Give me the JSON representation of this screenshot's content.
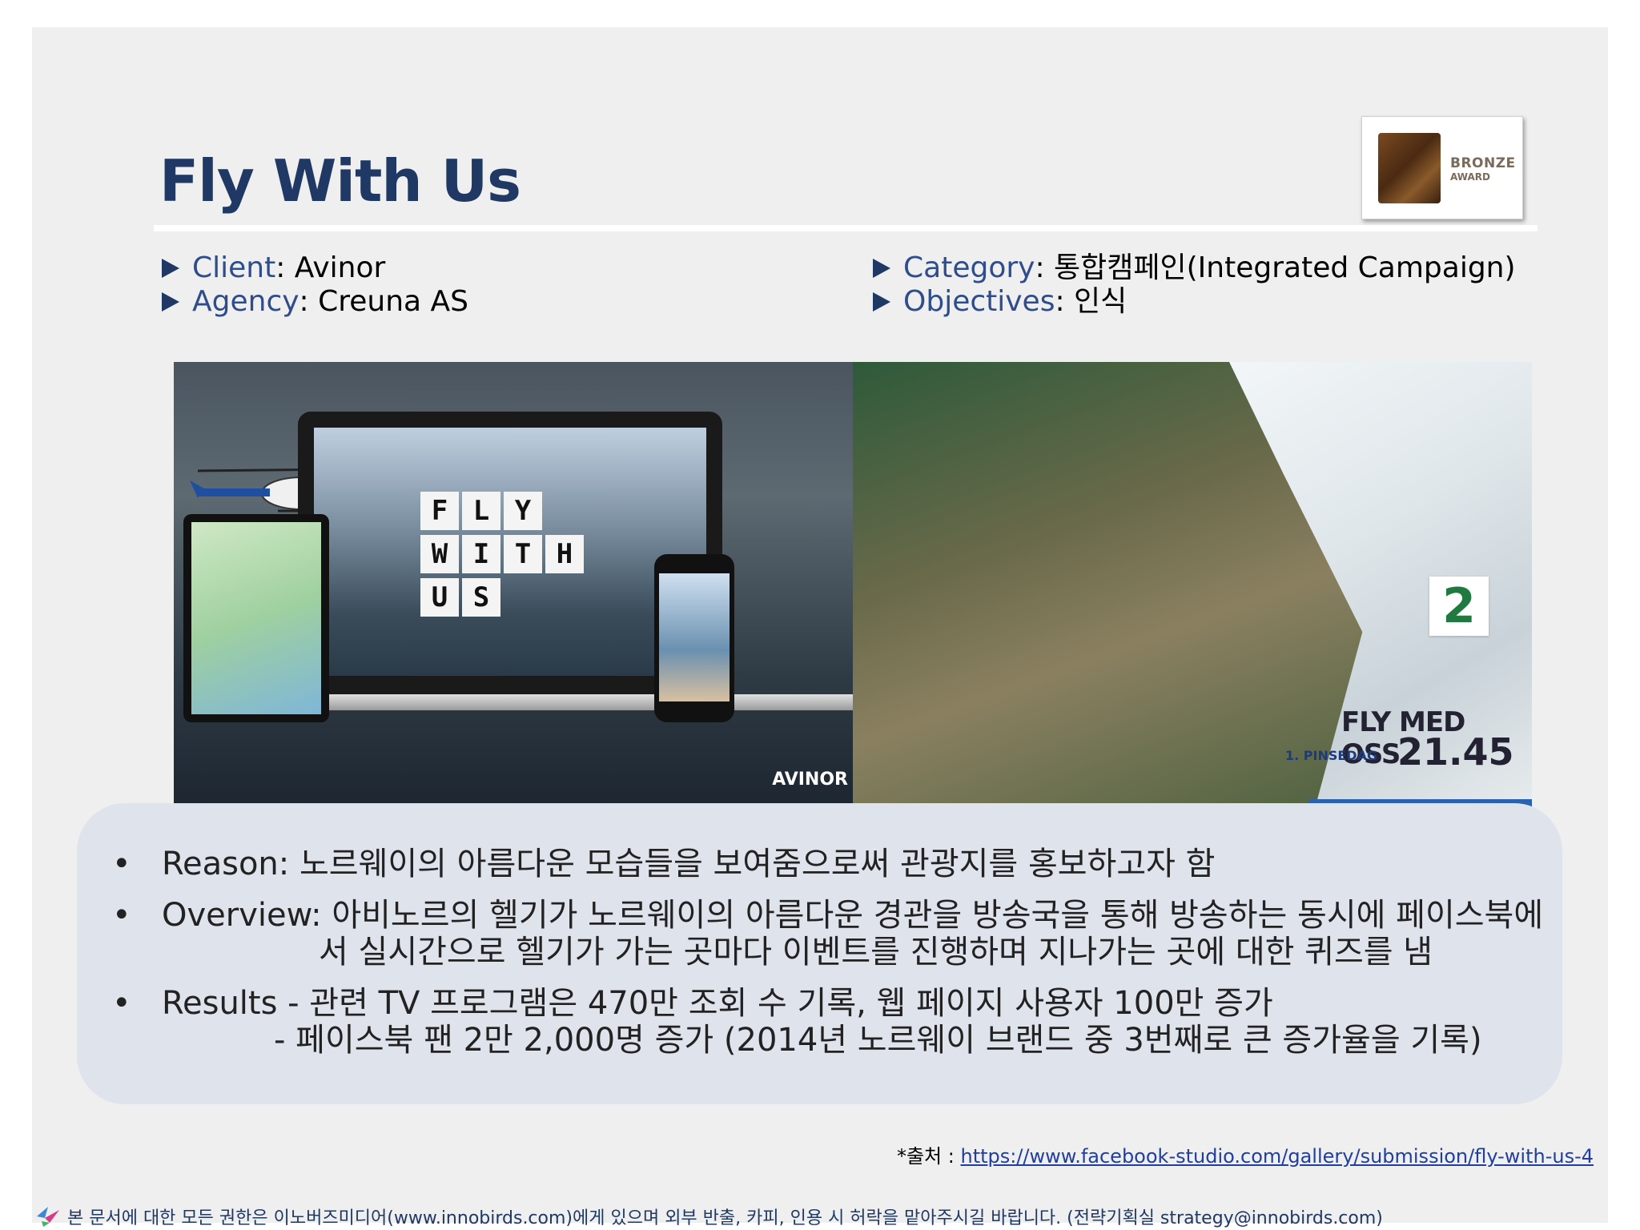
{
  "slide": {
    "title": "Fly With Us",
    "award": {
      "line1": "BRONZE",
      "line2": "AWARD"
    }
  },
  "meta": {
    "client_key": "Client",
    "client_value": ": Avinor",
    "agency_key": "Agency",
    "agency_value": ": Creuna AS",
    "category_key": "Category",
    "category_value": ": 통합캠페인(Integrated Campaign)",
    "objectives_key": "Objectives",
    "objectives_value": ": 인식"
  },
  "images": {
    "left": {
      "fws_rows": [
        [
          "F",
          "L",
          "Y"
        ],
        [
          "W",
          "I",
          "T",
          "H"
        ],
        [
          "U",
          "S"
        ]
      ],
      "brand": "AVINOR"
    },
    "right": {
      "channel_logo": "2",
      "show_title": "FLY MED OSS",
      "show_date": "1. PINSEDAG",
      "show_time": "21.45"
    }
  },
  "bullets": {
    "marker": "•",
    "reason": "Reason: 노르웨이의 아름다운 모습들을 보여줌으로써 관광지를 홍보하고자 함",
    "overview_1": "Overview: 아비노르의 헬기가 노르웨이의 아름다운 경관을 방송국을 통해 방송하는 동시에 페이스북에",
    "overview_2": "서 실시간으로 헬기가 가는 곳마다 이벤트를 진행하며 지나가는 곳에 대한 퀴즈를 냄",
    "results_1": "Results - 관련 TV 프로그램은 470만 조회 수 기록, 웹 페이지 사용자 100만 증가",
    "results_2": "- 페이스북 팬 2만 2,000명 증가 (2014년 노르웨이 브랜드 중 3번째로 큰 증가율을 기록)"
  },
  "source": {
    "label": "*출처 : ",
    "url": "https://www.facebook-studio.com/gallery/submission/fly-with-us-4"
  },
  "footer": {
    "text": "본 문서에 대한 모든 권한은 이노버즈미디어(www.innobirds.com)에게 있으며 외부 반출, 카피, 인용 시 허락을 맡아주시길 바랍니다. (전략기획실 strategy@innobirds.com)"
  },
  "colors": {
    "title": "#1f3864",
    "key": "#2e4d8a",
    "panel": "#dfe3ec",
    "link": "#1f3ea0"
  }
}
